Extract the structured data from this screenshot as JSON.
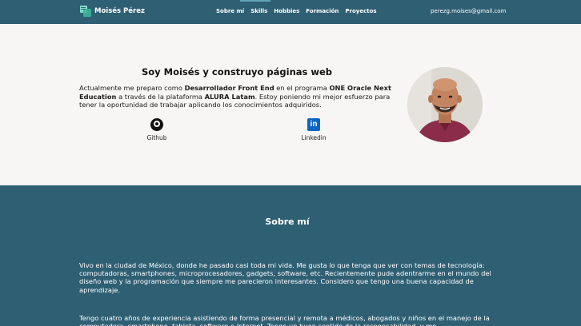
{
  "header": {
    "brand": "Moisés Pérez",
    "nav": [
      "Sobre mí",
      "Skills",
      "Hobbies",
      "Formación",
      "Proyectos"
    ],
    "email": "perezg.moises@gmail.com"
  },
  "hero": {
    "title": "Soy Moisés y construyo páginas web",
    "desc_1": "Actualmente me preparo como ",
    "desc_b1": "Desarrollador Front End",
    "desc_2": " en el programa ",
    "desc_b2": "ONE Oracle Next Education",
    "desc_3": " a través de la plataforma ",
    "desc_b3": "ALURA Latam",
    "desc_4": ". Estoy poniendo mi mejor esfuerzo para tener la oportunidad de trabajar aplicando los conocimientos adquiridos.",
    "github_label": "Github",
    "linkedin_label": "Linkedin",
    "linkedin_glyph": "in"
  },
  "about": {
    "title": "Sobre mí",
    "p1": "Vivo en la ciudad de México, donde he pasado casi toda mi vida. Me gusta lo que tenga que ver con temas de tecnología: computadoras, smartphones, microprocesadores, gadgets, software, etc. Recientemente pude adentrarme en el mundo del diseño web y la programación que siempre me parecieron interesantes. Considero que tengo una buena capacidad de aprendizaje.",
    "p2": "Tengo cuatro años de experiencia asistiendo de forma presencial y remota a médicos, abogados y niños en el manejo de la computadora, smartphone, tableta, software e Internet. Tengo un buen sentido de la responsabilidad, y me"
  },
  "colors": {
    "primary": "#2f5f73",
    "background": "#f7f6f5",
    "accent": "#5fa7b6"
  },
  "icons": {
    "logo": "code-window-icon",
    "github": "github-icon",
    "linkedin": "linkedin-icon"
  }
}
